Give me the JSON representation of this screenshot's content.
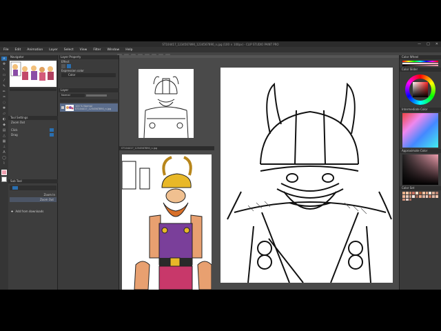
{
  "window": {
    "title": "ST104417_1234567890_1234567890_n.jpg (100 × 100px) - CLIP STUDIO PAINT PRO",
    "controls": [
      "—",
      "□",
      "✕"
    ]
  },
  "menu": [
    "File",
    "Edit",
    "Animation",
    "Layer",
    "Select",
    "View",
    "Filter",
    "Window",
    "Help"
  ],
  "panels": {
    "navigator": "Navigator",
    "tool_settings": "Tool Settings",
    "zoom_label": "Zoom Out",
    "zoom_in": "Zoom In",
    "drag": "Drag",
    "click": "Click",
    "sub_tool": "Sub Tool",
    "layer_property": "Layer Property",
    "effect": "Effect",
    "expression_color": "Expression color",
    "expression_value": "Color",
    "layer": "Layer",
    "layer_blend": "Normal",
    "layer_name": "100 % Normal",
    "layer_sub": "ST104417_1234567890_n.jpg",
    "add_downloads": "Add from downloads",
    "color_wheel": "Color Wheel",
    "color_slider": "Color Slider",
    "color_set": "Color Set",
    "intermediate": "Intermediate Color",
    "approximate": "Approximate Color",
    "color_history": "Color History"
  },
  "tabs": {
    "left_canvas": "ST104417_1234567890_n.jpg",
    "main_canvas": "ST104417_1234567890_n.jpg"
  },
  "colors": {
    "accent": "#2a6fb0",
    "fg_color": "#f0a0b0"
  }
}
